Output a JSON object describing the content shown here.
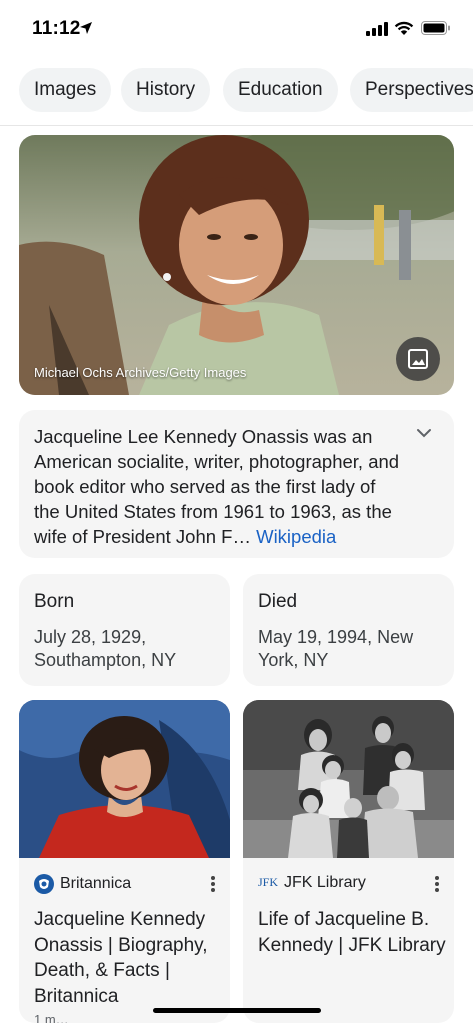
{
  "status": {
    "time": "11:12"
  },
  "chips": [
    "Images",
    "History",
    "Education",
    "Perspectives"
  ],
  "hero": {
    "credit": "Michael Ochs Archives/Getty Images"
  },
  "description": {
    "text": "Jacqueline Lee Kennedy Onassis was an American socialite, writer, photographer, and book editor who served as the first lady of the United States from 1961 to 1963, as the wife of President John F…",
    "link": "Wikipedia"
  },
  "facts": [
    {
      "label": "Born",
      "value": "July 28, 1929, Southampton, NY"
    },
    {
      "label": "Died",
      "value": "May 19, 1994, New York, NY"
    }
  ],
  "articles": [
    {
      "source": "Britannica",
      "title": "Jacqueline Kennedy Onassis | Biography, Death, & Facts | Britannica",
      "meta": "1 m…"
    },
    {
      "source": "JFK Library",
      "source_icon_text": "JFK",
      "title": "Life of Jacqueline B. Kennedy | JFK Library"
    }
  ],
  "colors": {
    "link": "#1a62c5",
    "card_bg": "#f5f5f5",
    "chip_bg": "#f1f3f4"
  },
  "icons": [
    "location-arrow-icon",
    "cellular-signal-icon",
    "wifi-icon",
    "battery-icon",
    "image-icon",
    "chevron-down-icon",
    "more-vert-icon",
    "britannica-logo-icon",
    "jfk-library-logo-icon"
  ]
}
